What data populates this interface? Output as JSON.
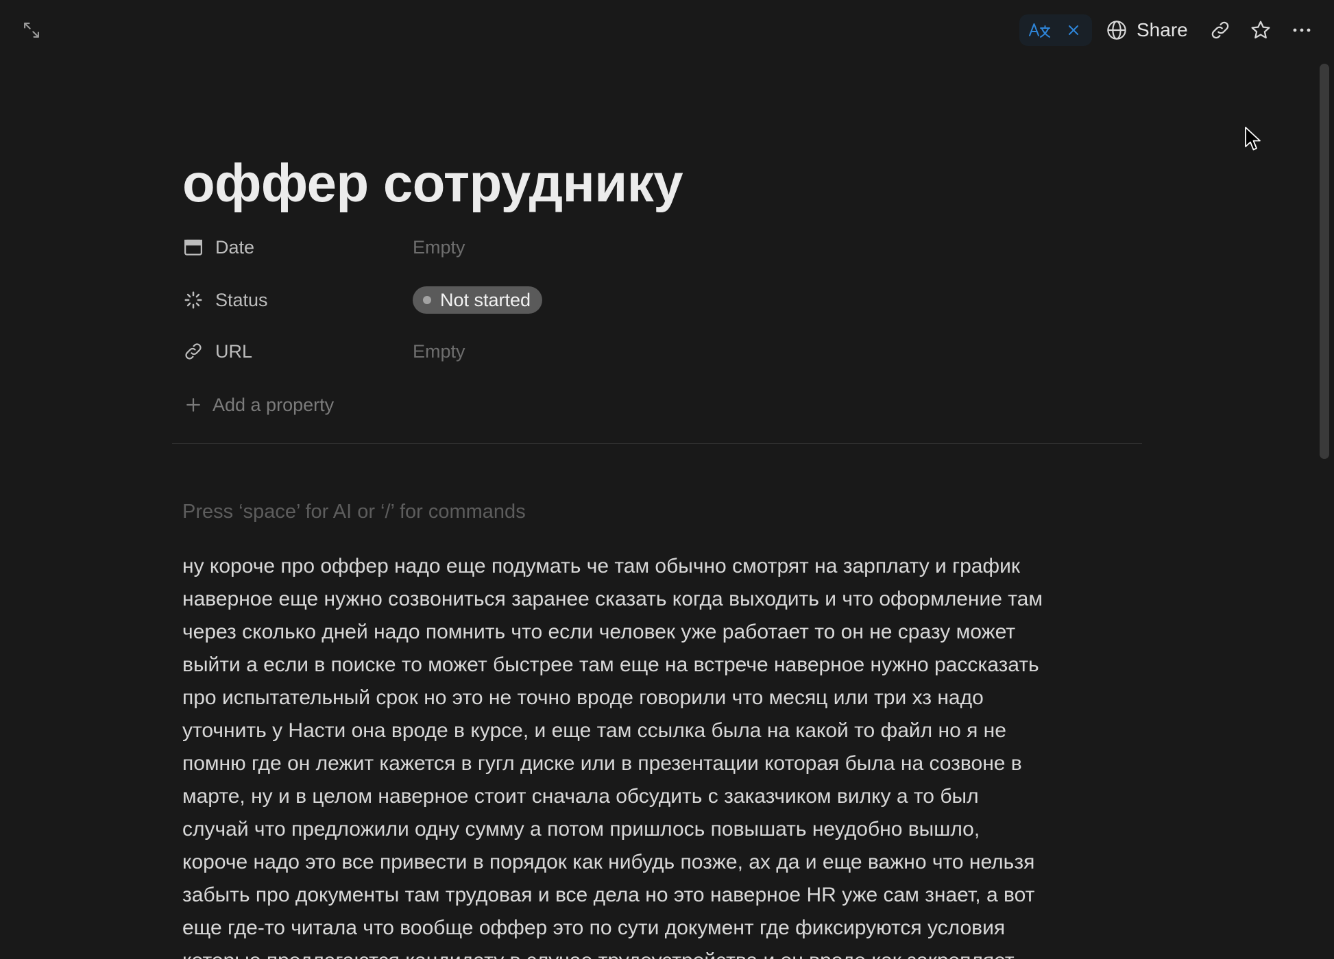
{
  "topbar": {
    "expand_icon": "expand-icon",
    "translate_icon": "translate-icon",
    "translate_close_icon": "close-icon",
    "share_icon": "globe-icon",
    "share_label": "Share",
    "copy_link_icon": "link-icon",
    "favorite_icon": "star-icon",
    "more_icon": "more-icon"
  },
  "page": {
    "title": "оффер сотруднику"
  },
  "properties": [
    {
      "icon": "calendar-icon",
      "label": "Date",
      "value": "Empty"
    },
    {
      "icon": "status-icon",
      "label": "Status",
      "value": "Not started"
    },
    {
      "icon": "link-icon",
      "label": "URL",
      "value": "Empty"
    }
  ],
  "add_property": {
    "icon": "plus-icon",
    "label": "Add a property"
  },
  "editor": {
    "placeholder": "Press ‘space’ for AI or ‘/’ for commands",
    "lines": [
      "ну короче про оффер надо еще подумать че там обычно смотрят на зарплату и график",
      "наверное еще нужно созвониться заранее сказать когда выходить и что оформление там",
      "через сколько дней надо помнить что если человек уже работает то он не сразу может",
      "выйти а если в поиске то может быстрее там еще на встрече наверное нужно рассказать",
      "про испытательный срок но это не точно вроде говорили что месяц или три хз надо",
      "уточнить у Насти она вроде в курсе, и еще там ссылка была на какой то файл но я не",
      "помню где он лежит кажется в гугл диске или в презентации которая была на созвоне в",
      "марте, ну и в целом наверное стоит сначала обсудить с заказчиком вилку а то был",
      "случай что предложили одну сумму а потом пришлось повышать неудобно вышло,",
      "короче надо это все привести в порядок как нибудь позже, ах да и еще важно что нельзя",
      "забыть про документы там трудовая и все дела но это наверное HR уже сам знает, а вот",
      "еще где-то читала что вообще оффер это по сути документ где фиксируются условия",
      "которые предлагаются кандидату в случае трудоустройства и он вроде как закрепляет"
    ]
  },
  "colors": {
    "background": "#191919",
    "accent": "#2e85d8",
    "status_pill": "#5a5a5a",
    "status_dot": "#a3a3a3"
  }
}
